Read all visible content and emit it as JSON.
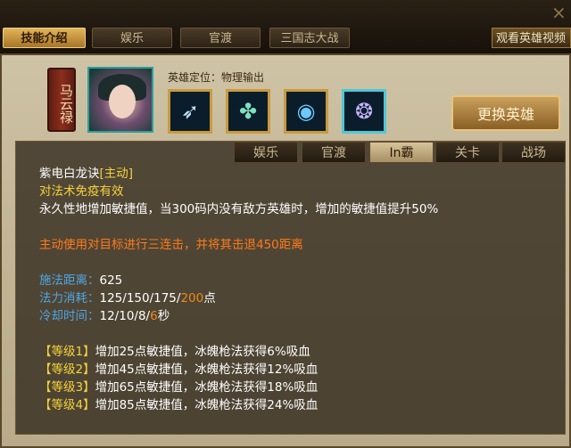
{
  "top_tabs": [
    "技能介绍",
    "娱乐",
    "官渡",
    "三国志大战"
  ],
  "video_label": "观看英雄视频",
  "close_label": "×",
  "hero": {
    "name": "马云禄",
    "role": "英雄定位：物理输出",
    "change_label": "更换英雄"
  },
  "sub_tabs": [
    "娱乐",
    "官渡",
    "In霸",
    "关卡",
    "战场"
  ],
  "skill": {
    "name": "紫电白龙诀",
    "type_tag": "[主动]",
    "immune": "对法术免疫有效",
    "passive_desc": "永久性地增加敏捷值，当300码内没有敌方英雄时，增加的敏捷值提升50%",
    "active_desc": "主动使用对目标进行三连击，并将其击退450距离",
    "range_label": "施法距离：",
    "range_value": "625",
    "mana_label": "法力消耗：",
    "mana_value": "125/150/175/",
    "mana_highlight": "200",
    "mana_unit": "点",
    "cd_label": "冷却时间：",
    "cd_value": "12/10/8/",
    "cd_highlight": "6",
    "cd_unit": "秒"
  },
  "levels": [
    {
      "tag": "【等级1】",
      "text": "增加25点敏捷值，冰魄枪法获得6%吸血"
    },
    {
      "tag": "【等级2】",
      "text": "增加45点敏捷值，冰魄枪法获得12%吸血"
    },
    {
      "tag": "【等级3】",
      "text": "增加65点敏捷值，冰魄枪法获得18%吸血"
    },
    {
      "tag": "【等级4】",
      "text": "增加85点敏捷值，冰魄枪法获得24%吸血"
    }
  ],
  "icons": [
    "lance-skill-icon",
    "rune-skill-icon",
    "orb-skill-icon",
    "dragon-skill-icon"
  ]
}
